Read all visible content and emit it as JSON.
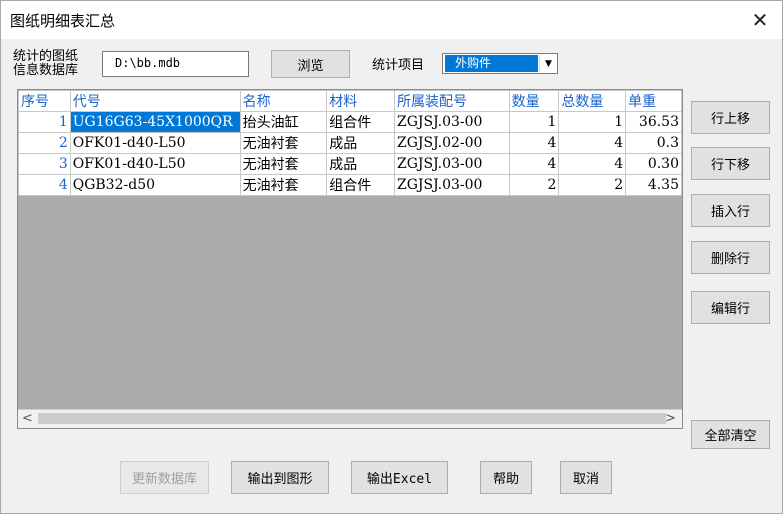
{
  "window": {
    "title": "图纸明细表汇总",
    "close": "✕"
  },
  "db": {
    "label_line1": "统计的图纸",
    "label_line2": "信息数据库",
    "path": "D:\\bb.mdb",
    "browse": "浏览"
  },
  "stat": {
    "label": "统计项目",
    "value": "外购件"
  },
  "grid": {
    "headers": [
      "序号",
      "代号",
      "名称",
      "材料",
      "所属装配号",
      "数量",
      "总数量",
      "单重"
    ],
    "rows": [
      [
        "1",
        "UG16G63-45X1000QR",
        "抬头油缸",
        "组合件",
        "ZGJSJ.03-00",
        "1",
        "1",
        "36.53"
      ],
      [
        "2",
        "OFK01-d40-L50",
        "无油衬套",
        "成品",
        "ZGJSJ.02-00",
        "4",
        "4",
        "0.3"
      ],
      [
        "3",
        "OFK01-d40-L50",
        "无油衬套",
        "成品",
        "ZGJSJ.03-00",
        "4",
        "4",
        "0.30"
      ],
      [
        "4",
        "QGB32-d50",
        "无油衬套",
        "组合件",
        "ZGJSJ.03-00",
        "2",
        "2",
        "4.35"
      ]
    ]
  },
  "side_buttons": {
    "move_up": "行上移",
    "move_down": "行下移",
    "insert": "插入行",
    "delete": "删除行",
    "edit": "编辑行",
    "clear_all": "全部清空"
  },
  "bottom_buttons": {
    "update_db": "更新数据库",
    "export_drawing": "输出到图形",
    "export_excel": "输出Excel",
    "help": "帮助",
    "cancel": "取消"
  }
}
